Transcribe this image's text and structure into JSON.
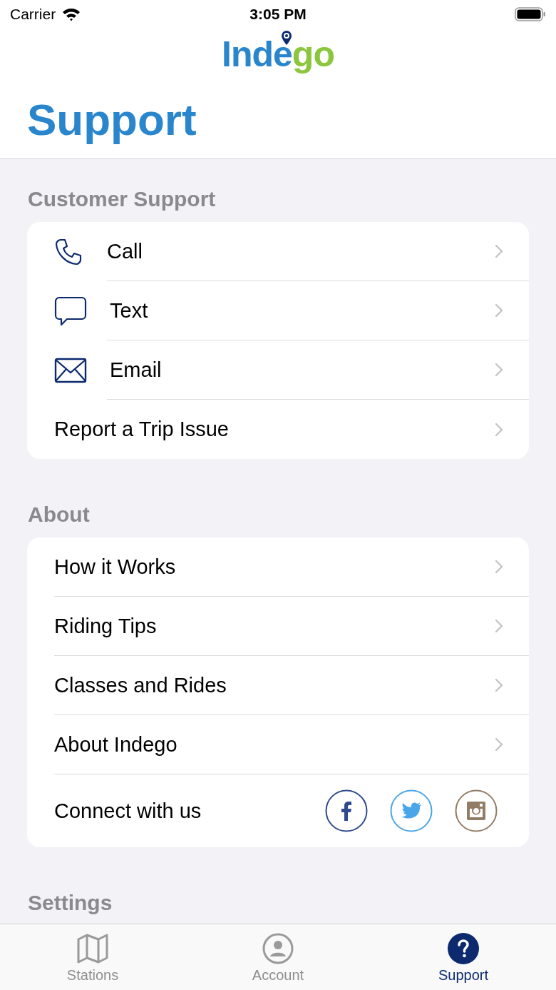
{
  "status_bar": {
    "carrier": "Carrier",
    "time": "3:05 PM"
  },
  "logo": [
    {
      "text": "Inde",
      "color": "#2a86cc"
    },
    {
      "text": "go",
      "color": "#8cc63f"
    }
  ],
  "title": "Support",
  "sections": [
    {
      "header": "Customer Support",
      "items": [
        {
          "kind": "phone",
          "label": "Call"
        },
        {
          "kind": "chat",
          "label": "Text"
        },
        {
          "kind": "mail",
          "label": "Email"
        },
        {
          "kind": "plain",
          "label": "Report a Trip Issue"
        }
      ]
    },
    {
      "header": "About",
      "items": [
        {
          "kind": "plain",
          "label": "How it Works"
        },
        {
          "kind": "plain",
          "label": "Riding Tips"
        },
        {
          "kind": "plain",
          "label": "Classes and Rides"
        },
        {
          "kind": "plain",
          "label": "About Indego"
        },
        {
          "kind": "social",
          "label": "Connect with us"
        }
      ]
    },
    {
      "header": "Settings"
    }
  ],
  "tabs": [
    {
      "kind": "map",
      "label": "Stations",
      "selected": false
    },
    {
      "kind": "person",
      "label": "Account",
      "selected": false
    },
    {
      "kind": "help",
      "label": "Support",
      "selected": true
    }
  ]
}
